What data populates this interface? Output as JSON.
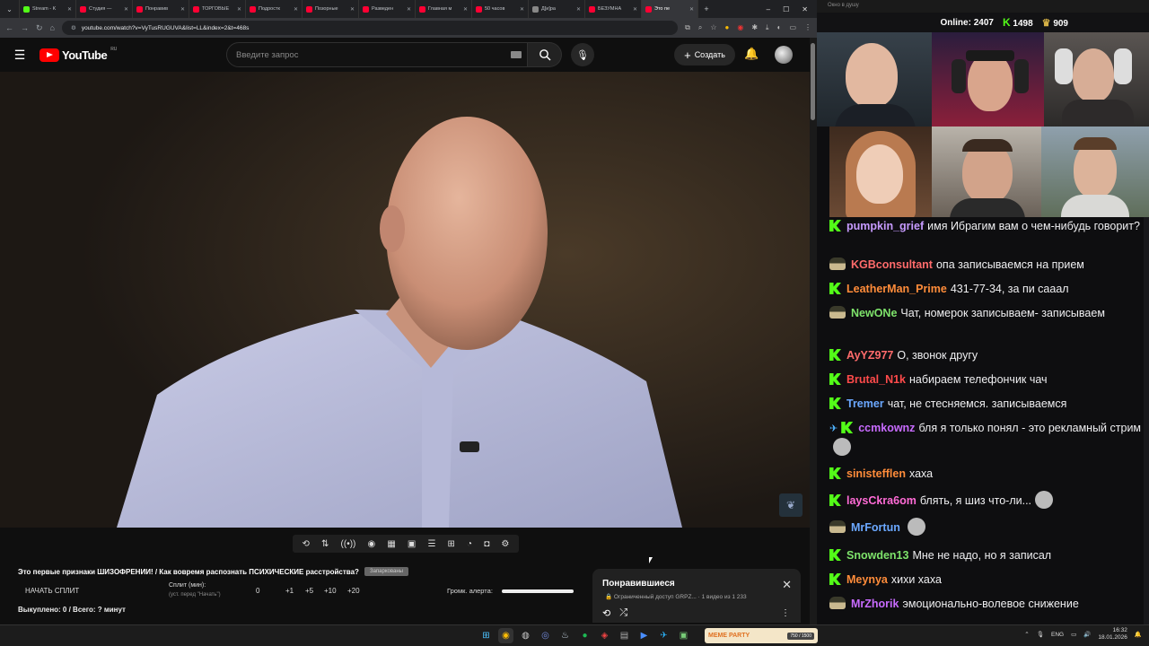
{
  "browser": {
    "tabs": [
      {
        "label": "Stream - K",
        "color": "#53fc18"
      },
      {
        "label": "Студия — ",
        "color": "#ff0033"
      },
      {
        "label": "Понравив",
        "color": "#ff0033"
      },
      {
        "label": "ТОРГОВЫЕ",
        "color": "#ff0033"
      },
      {
        "label": "Подростк",
        "color": "#ff0033"
      },
      {
        "label": "Позорные",
        "color": "#ff0033"
      },
      {
        "label": "Разведен",
        "color": "#ff0033"
      },
      {
        "label": "Главная м",
        "color": "#ff0033"
      },
      {
        "label": "50 часов ",
        "color": "#ff0033"
      },
      {
        "label": "Д[и]ра",
        "color": "#888888"
      },
      {
        "label": "БЕЗУМНА",
        "color": "#ff0033"
      },
      {
        "label": "Это пе",
        "color": "#ff0033"
      }
    ],
    "url": "youtube.com/watch?v=VyTusRUGUVA&list=LL&index=2&t=468s"
  },
  "youtube": {
    "logo_text": "YouTube",
    "region": "RU",
    "search_placeholder": "Введите запрос",
    "create_label": "Создать"
  },
  "video": {
    "title": "Это первые признаки ШИЗОФРЕНИИ! / Как вовремя распознать ПСИХИЧЕСКИЕ расстройства?",
    "chip": "Запаркованы"
  },
  "split": {
    "start_label": "НАЧАТЬ СПЛИТ",
    "split_label": "Сплит (мин):",
    "split_sub": "(уст. перед \"Начать\")",
    "value": "0",
    "inc1": "+1",
    "inc5": "+5",
    "inc10": "+10",
    "inc20": "+20",
    "alert_label": "Громк. алерта:",
    "alert_volume": 1.0,
    "result": "Выкуплено: 0 / Всего: ? минут"
  },
  "liked_panel": {
    "title": "Понравившиеся",
    "meta": "Ограниченный доступ GRPZ... · 1 видео из 1 233"
  },
  "meme_widget": {
    "title": "MEME PARTY",
    "count": "750 / 1500"
  },
  "tray": {
    "lang": "ENG",
    "time": "16:32",
    "date": "18.01.2026"
  },
  "stream": {
    "popout_title": "Окно в душу",
    "online_label": "Online:",
    "online": "2407",
    "followers": "1498",
    "subs": "909"
  },
  "chat": [
    {
      "user": "pumpkin_grief",
      "color": "#c79bff",
      "badge": "k",
      "text": "имя Ибрагим вам о чем-нибудь говорит?"
    },
    {
      "user": "KGBconsultant",
      "color": "#ff6b6b",
      "badge": "hat",
      "text": "опа записываемся на прием"
    },
    {
      "user": "LeatherMan_Prime",
      "color": "#ff8c3a",
      "badge": "k",
      "text": "431-77-34, за пи сааал"
    },
    {
      "user": "NewONe",
      "color": "#7ee36b",
      "badge": "hat",
      "text": "Чат, номерок записываем- записываем"
    },
    {
      "user": "AyYZ977",
      "color": "#ff6b6b",
      "badge": "k",
      "text": "О, звонок другу"
    },
    {
      "user": "Brutal_N1k",
      "color": "#ff4b4b",
      "badge": "k",
      "text": "набираем телефончик чач"
    },
    {
      "user": "Tremer",
      "color": "#6ba8ff",
      "badge": "k",
      "text": "чат, не стесняемся. записываемся"
    },
    {
      "user": "ccmkownz",
      "color": "#c86bff",
      "badge": "k",
      "text": "бля я только понял - это рекламный стрим"
    },
    {
      "user": "sinistefflen",
      "color": "#ff8c3a",
      "badge": "k",
      "text": "хаха"
    },
    {
      "user": "laysCkra6om",
      "color": "#ff6bd6",
      "badge": "k",
      "text": "блять, я шиз что-ли..."
    },
    {
      "user": "MrFortun",
      "color": "#6ba8ff",
      "badge": "hat",
      "text": ""
    },
    {
      "user": "Snowden13",
      "color": "#7ee36b",
      "badge": "k",
      "text": "Мне не надо, но я записал"
    },
    {
      "user": "Meynya",
      "color": "#ff8c3a",
      "badge": "k",
      "text": "хихи хаха"
    },
    {
      "user": "MrZhorik",
      "color": "#c86bff",
      "badge": "hat",
      "text": "эмоционально-волевое снижение"
    }
  ]
}
